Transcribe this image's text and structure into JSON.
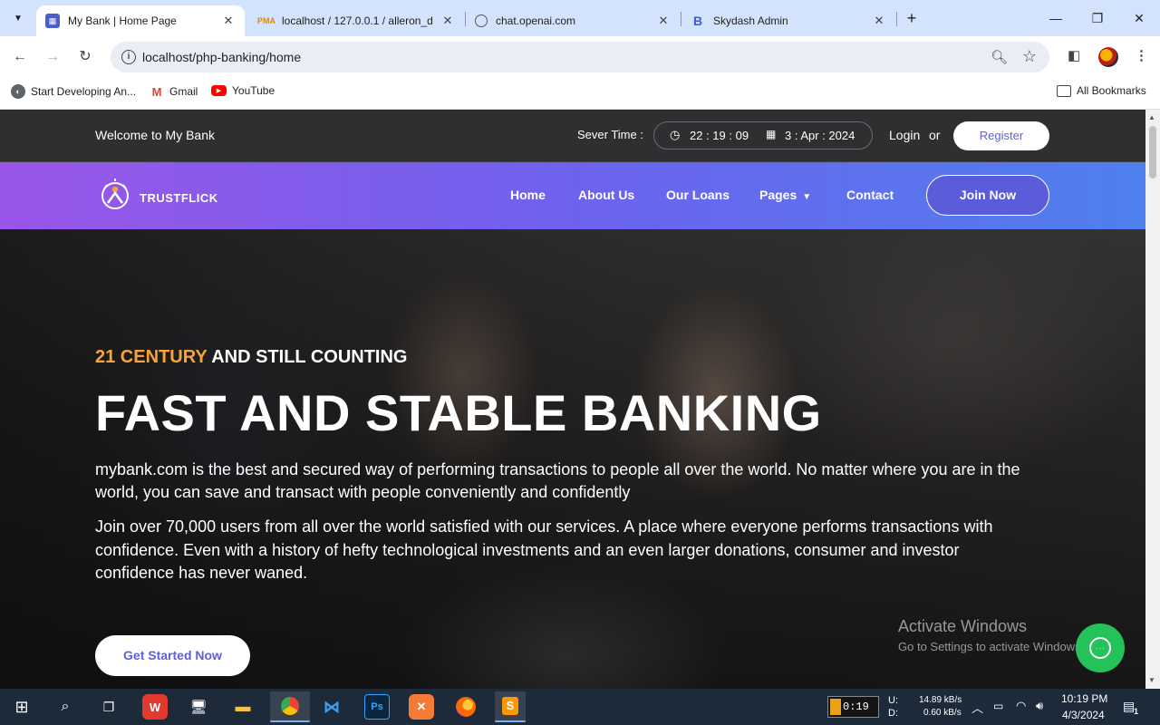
{
  "browser": {
    "tabs": [
      {
        "title": "My Bank | Home Page",
        "active": true
      },
      {
        "title": "localhost / 127.0.0.1 / alleron_d",
        "active": false
      },
      {
        "title": "chat.openai.com",
        "active": false
      },
      {
        "title": "Skydash Admin",
        "active": false
      }
    ],
    "url": "localhost/php-banking/home",
    "bookmarks": [
      "Start Developing An...",
      "Gmail",
      "YouTube"
    ],
    "all_bookmarks": "All Bookmarks"
  },
  "site": {
    "topbar": {
      "welcome": "Welcome to My Bank",
      "server_label": "Sever Time :",
      "time": "22 : 19 : 09",
      "date": "3 : Apr : 2024",
      "login": "Login",
      "or": "or",
      "register": "Register"
    },
    "logo": "TRUSTFLICK",
    "nav": [
      "Home",
      "About Us",
      "Our Loans",
      "Pages",
      "Contact"
    ],
    "join_now": "Join Now",
    "hero": {
      "eyebrow_accent": "21 CENTURY",
      "eyebrow_rest": " AND STILL COUNTING",
      "headline": "FAST AND STABLE BANKING",
      "para1": "mybank.com is the best and secured way of performing transactions to people all over the world. No matter where you are in the world, you can save and transact with people conveniently and confidently",
      "para2": "Join over 70,000 users from all over the world satisfied with our services. A place where everyone performs transactions with confidence. Even with a history of hefty technological investments and an even larger donations, consumer and investor confidence has never waned.",
      "cta": "Get Started Now"
    }
  },
  "watermark": {
    "line1": "Activate Windows",
    "line2": "Go to Settings to activate Windows."
  },
  "taskbar": {
    "media_time": "0:19",
    "net_up_label": "U:",
    "net_down_label": "D:",
    "net_up": "14.89 kB/s",
    "net_down": "0.60 kB/s",
    "clock_time": "10:19 PM",
    "clock_date": "4/3/2024",
    "notifications": "1"
  },
  "colors": {
    "accent_orange": "#f9a43a",
    "nav_gradient_start": "#9a56e8",
    "nav_gradient_end": "#4f80ee",
    "button_text": "#5b5fe0",
    "chat_green": "#25c15a"
  }
}
